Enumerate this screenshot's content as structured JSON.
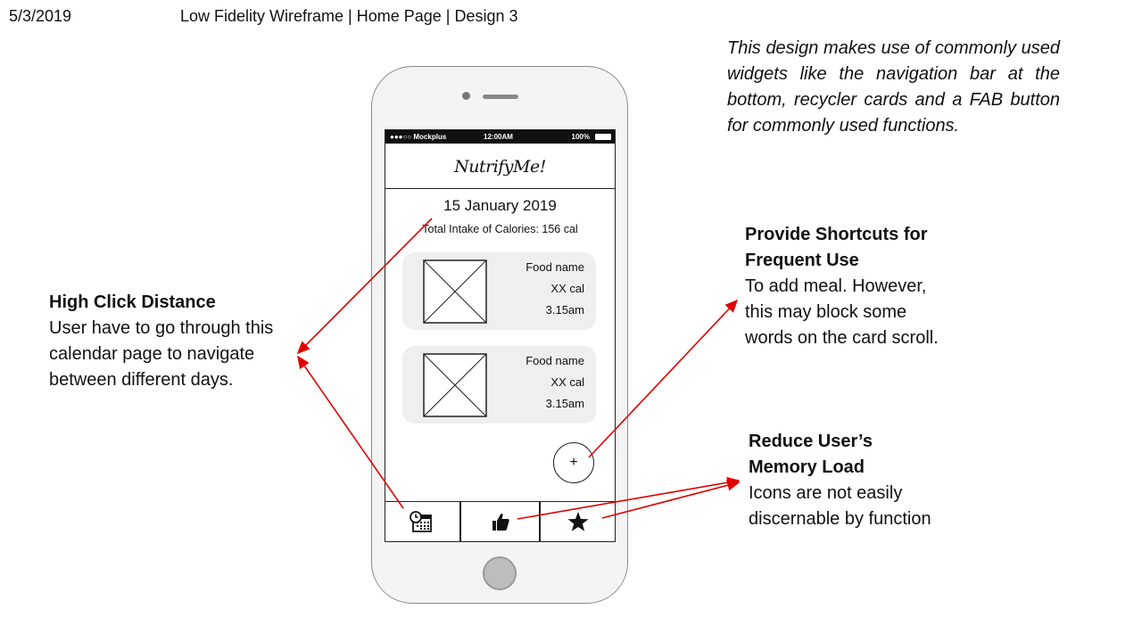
{
  "header": {
    "date": "5/3/2019",
    "title": "Low Fidelity Wireframe  | Home Page | Design 3"
  },
  "description": "This design makes use of commonly used widgets like the navigation bar at the bottom, recycler cards and a FAB button for commonly used functions.",
  "notes": {
    "click_distance": {
      "title": "High Click Distance",
      "body": "User have to go through this calendar page to navigate between different days."
    },
    "shortcuts": {
      "title_line1": "Provide Shortcuts for",
      "title_line2": "Frequent Use",
      "body": "To add meal. However, this may block some words on the card scroll."
    },
    "memory": {
      "title_line1": "Reduce User’s",
      "title_line2": "Memory Load",
      "body": "Icons are not easily discernable by function"
    }
  },
  "phone": {
    "status": {
      "left": "●●●○○ Mockplus",
      "time": "12:00AM",
      "battery": "100%"
    },
    "app_title": "NutrifyMe!",
    "date": "15 January 2019",
    "total_intake": "Total Intake of Calories: 156 cal",
    "cards": [
      {
        "name": "Food name",
        "cal": "XX cal",
        "time": "3.15am"
      },
      {
        "name": "Food name",
        "cal": "XX cal",
        "time": "3.15am"
      }
    ],
    "fab_label": "+",
    "nav_icons": [
      "calendar-icon",
      "thumbs-up-icon",
      "star-icon"
    ]
  },
  "colors": {
    "annotation": "#e00000"
  }
}
